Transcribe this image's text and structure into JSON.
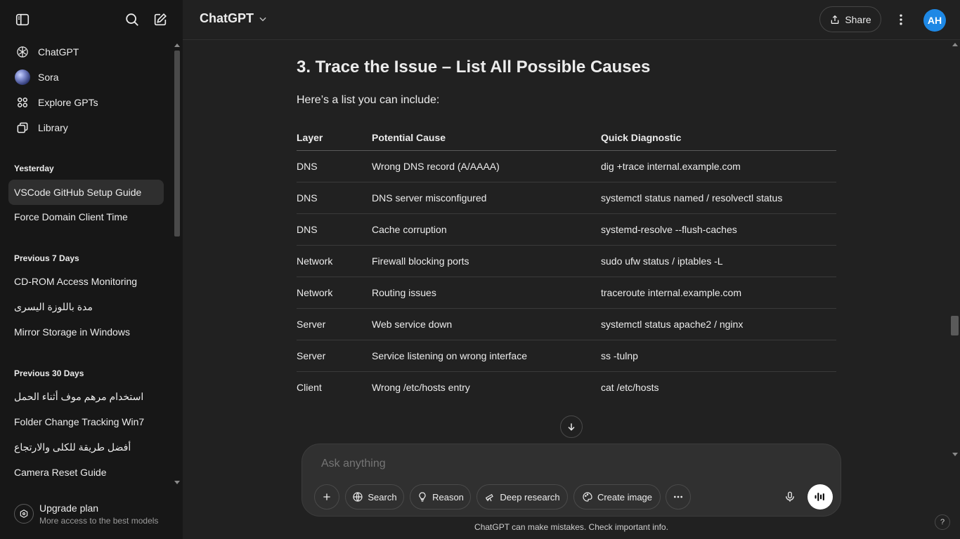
{
  "sidebar": {
    "nav": [
      {
        "label": "ChatGPT",
        "icon": "chatgpt-logo-icon"
      },
      {
        "label": "Sora",
        "icon": "sora-icon"
      },
      {
        "label": "Explore GPTs",
        "icon": "grid-icon"
      },
      {
        "label": "Library",
        "icon": "library-icon"
      }
    ],
    "sections": [
      {
        "title": "Yesterday",
        "items": [
          "VSCode GitHub Setup Guide",
          "Force Domain Client Time"
        ]
      },
      {
        "title": "Previous 7 Days",
        "items": [
          "CD-ROM Access Monitoring",
          "مدة باللوزة اليسرى",
          "Mirror Storage in Windows"
        ]
      },
      {
        "title": "Previous 30 Days",
        "items": [
          "استخدام مرهم موف أثناء الحمل",
          "Folder Change Tracking Win7",
          "أفضل طريقة للكلى والارتجاع",
          "Camera Reset Guide"
        ]
      }
    ],
    "upgrade": {
      "title": "Upgrade plan",
      "subtitle": "More access to the best models"
    }
  },
  "header": {
    "model": "ChatGPT",
    "share_label": "Share",
    "avatar_initials": "AH"
  },
  "content": {
    "heading": "3. Trace the Issue – List All Possible Causes",
    "intro": "Here’s a list you can include:",
    "table": {
      "headers": [
        "Layer",
        "Potential Cause",
        "Quick Diagnostic"
      ],
      "rows": [
        [
          "DNS",
          "Wrong DNS record (A/AAAA)",
          "dig +trace internal.example.com"
        ],
        [
          "DNS",
          "DNS server misconfigured",
          "systemctl status named / resolvectl status"
        ],
        [
          "DNS",
          "Cache corruption",
          "systemd-resolve --flush-caches"
        ],
        [
          "Network",
          "Firewall blocking ports",
          "sudo ufw status / iptables -L"
        ],
        [
          "Network",
          "Routing issues",
          "traceroute internal.example.com"
        ],
        [
          "Server",
          "Web service down",
          "systemctl status apache2 / nginx"
        ],
        [
          "Server",
          "Service listening on wrong interface",
          "ss -tulnp"
        ],
        [
          "Client",
          "Wrong /etc/hosts entry",
          "cat /etc/hosts"
        ]
      ]
    }
  },
  "composer": {
    "placeholder": "Ask anything",
    "tools": [
      "Search",
      "Reason",
      "Deep research",
      "Create image"
    ]
  },
  "footer": {
    "disclaimer": "ChatGPT can make mistakes. Check important info.",
    "help": "?"
  }
}
